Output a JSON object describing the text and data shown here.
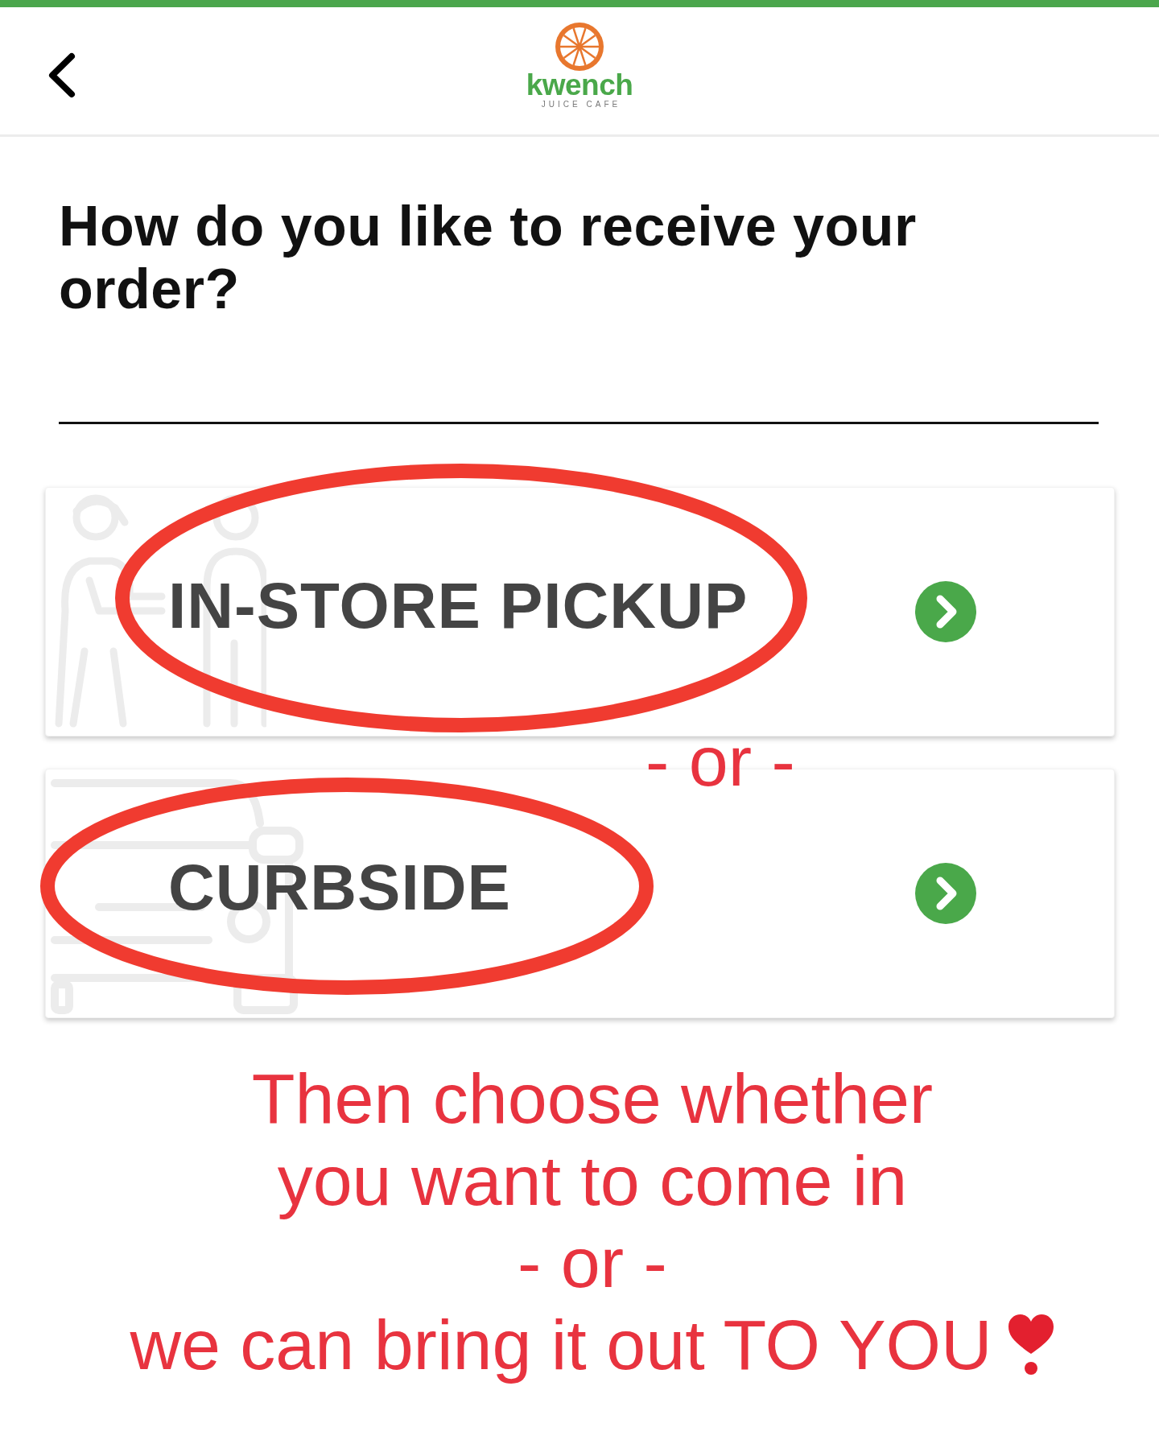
{
  "header": {
    "logo": {
      "name": "kwench",
      "tagline": "JUICE CAFE"
    }
  },
  "heading": "How do you like to receive your order?",
  "options": [
    {
      "kind": "pickup",
      "label": "IN-STORE PICKUP",
      "circled": true
    },
    {
      "kind": "curbside",
      "label": "CURBSIDE",
      "circled": true
    }
  ],
  "annotation": {
    "between_options": "- or -",
    "note_lines": [
      "Then choose whether",
      "you want to come in",
      "- or -",
      "we can bring it out TO YOU"
    ]
  }
}
